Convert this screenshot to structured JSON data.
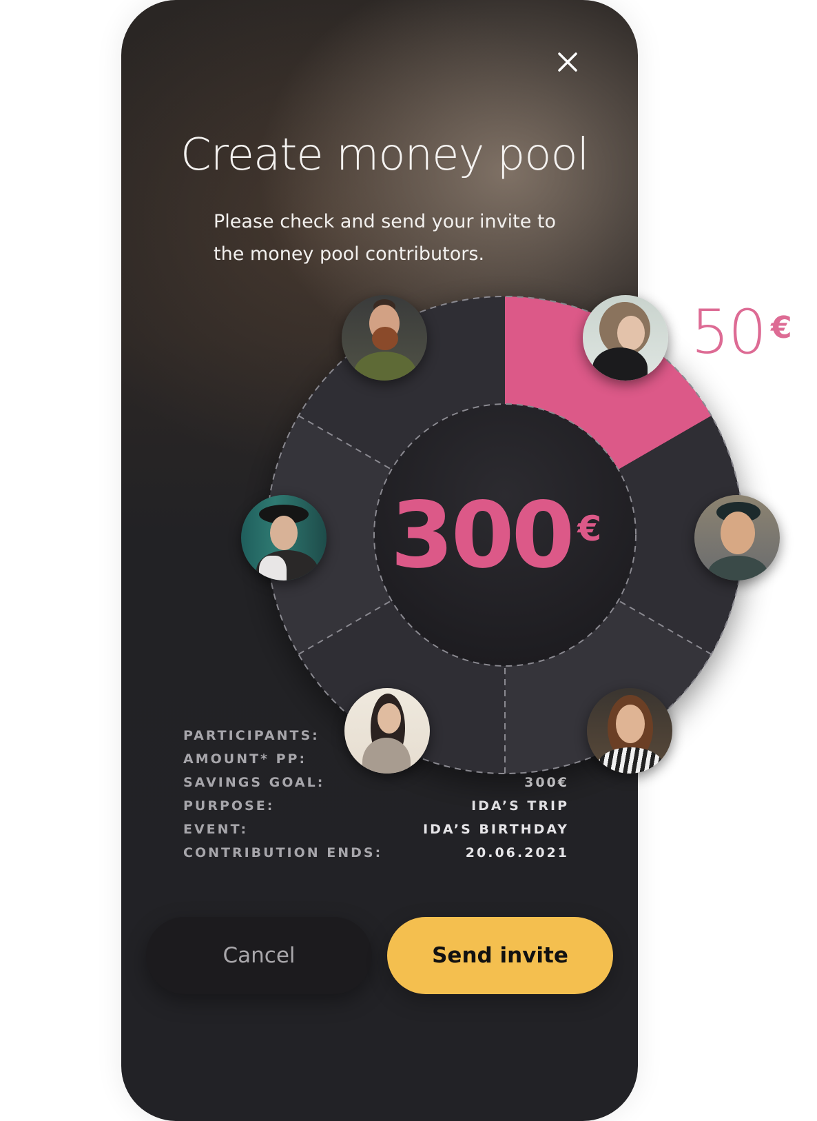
{
  "screen": {
    "title": "Create money pool",
    "subtitle": "Please check and send your invite to the money pool contributors."
  },
  "pool": {
    "total_amount": "300",
    "total_currency": "€",
    "share_amount": "50",
    "share_currency": "€",
    "participant_count": 6,
    "highlighted_segment": 1,
    "accent_color": "#dc5988"
  },
  "participants": [
    {
      "name": "man-beard",
      "highlighted": false
    },
    {
      "name": "woman-short-hair",
      "highlighted": true
    },
    {
      "name": "man-cap-smiling",
      "highlighted": false
    },
    {
      "name": "woman-striped-shirt",
      "highlighted": false
    },
    {
      "name": "woman-long-hair",
      "highlighted": false
    },
    {
      "name": "woman-black-hat",
      "highlighted": false
    }
  ],
  "info": [
    {
      "label": "PARTICIPANTS:",
      "value": ""
    },
    {
      "label": "AMOUNT* PP:",
      "value": ""
    },
    {
      "label": "SAVINGS GOAL:",
      "value": "300€"
    },
    {
      "label": "PURPOSE:",
      "value": "IDA’S TRIP"
    },
    {
      "label": "EVENT:",
      "value": "IDA’S BIRTHDAY"
    },
    {
      "label": "CONTRIBUTION ENDS:",
      "value": "20.06.2021"
    }
  ],
  "buttons": {
    "cancel": "Cancel",
    "send": "Send invite"
  },
  "colors": {
    "send_button": "#f4bf4f",
    "ring": "#343339"
  }
}
